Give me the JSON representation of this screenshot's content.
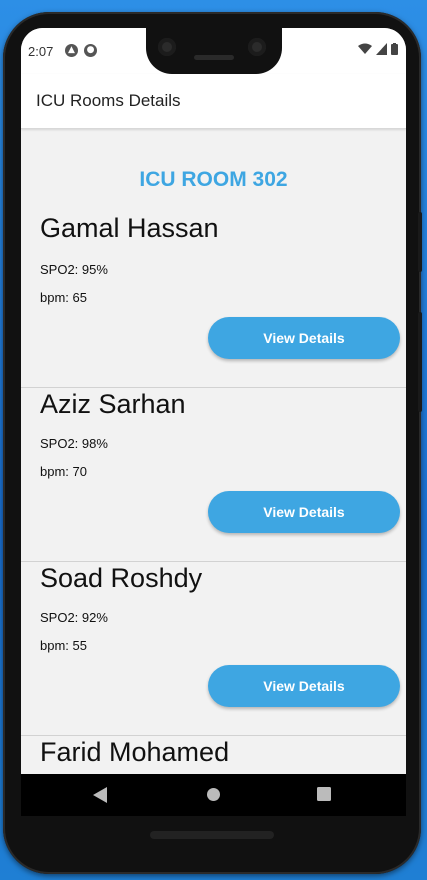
{
  "status_bar": {
    "time": "2:07",
    "icons_left": [
      "android-debug-icon",
      "react-icon"
    ],
    "icons_right": [
      "wifi-icon",
      "signal-icon",
      "battery-icon"
    ]
  },
  "appbar": {
    "title": "ICU Rooms Details"
  },
  "room": {
    "title": "ICU ROOM 302"
  },
  "patients": [
    {
      "name": "Gamal Hassan",
      "spo2": "SPO2: 95%",
      "bpm": "bpm: 65",
      "button": "View Details"
    },
    {
      "name": "Aziz Sarhan",
      "spo2": "SPO2: 98%",
      "bpm": "bpm: 70",
      "button": "View Details"
    },
    {
      "name": "Soad Roshdy",
      "spo2": "SPO2: 92%",
      "bpm": "bpm: 55",
      "button": "View Details"
    },
    {
      "name": "Farid Mohamed"
    }
  ],
  "nav": [
    "back-icon",
    "home-icon",
    "recent-apps-icon"
  ],
  "colors": {
    "accent": "#3ea6e2",
    "background": "#f2f2f2",
    "appbar": "#ffffff"
  }
}
